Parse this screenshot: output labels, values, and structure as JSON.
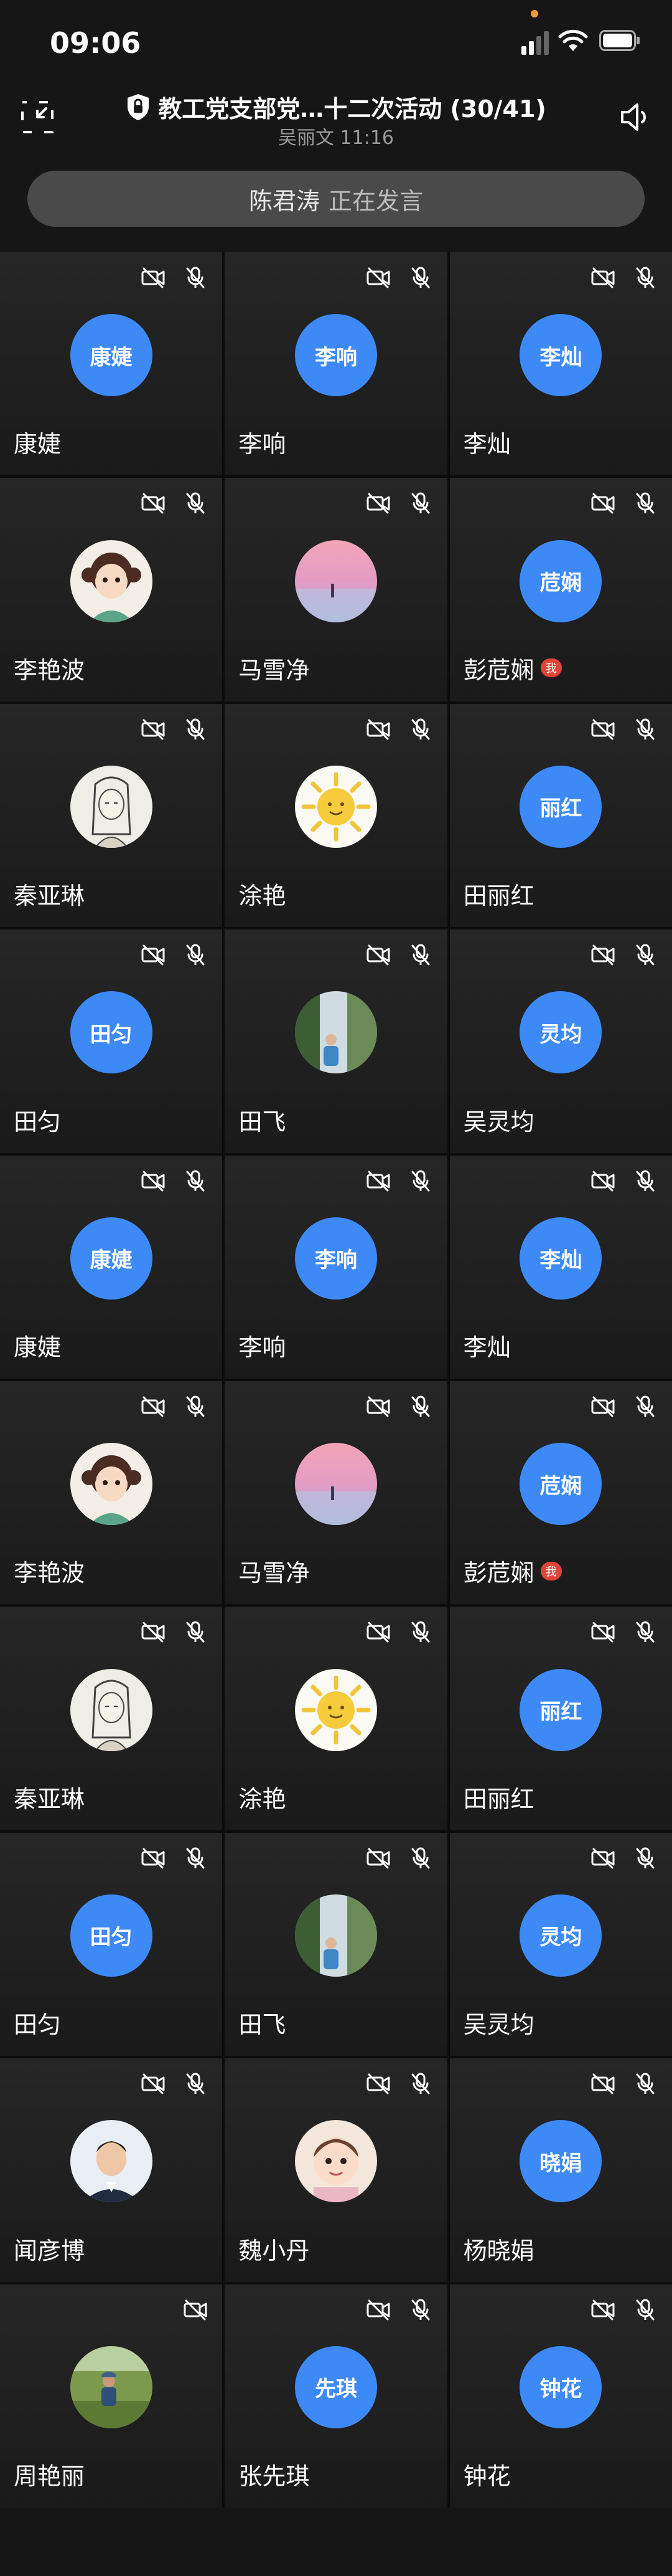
{
  "status_bar": {
    "time": "09:06"
  },
  "header": {
    "title": "教工党支部党…十二次活动 (30/41)",
    "subtitle": "吴丽文 11:16"
  },
  "speaking_banner": {
    "speaker": "陈君涛",
    "status": "正在发言"
  },
  "participants": [
    {
      "name": "康婕",
      "avatar_text": "康婕",
      "avatar_type": "text",
      "camera_off": true,
      "mic_off": true
    },
    {
      "name": "李响",
      "avatar_text": "李响",
      "avatar_type": "text",
      "camera_off": true,
      "mic_off": true
    },
    {
      "name": "李灿",
      "avatar_text": "李灿",
      "avatar_type": "text",
      "camera_off": true,
      "mic_off": true
    },
    {
      "name": "李艳波",
      "avatar_type": "photo",
      "avatar_icon": "cartoon-girl-avatar",
      "camera_off": true,
      "mic_off": true
    },
    {
      "name": "马雪净",
      "avatar_type": "photo",
      "avatar_icon": "sunset-avatar",
      "camera_off": true,
      "mic_off": true
    },
    {
      "name": "彭苊娴",
      "avatar_text": "苊娴",
      "avatar_type": "text",
      "camera_off": true,
      "mic_off": true,
      "badge": "我"
    },
    {
      "name": "秦亚琳",
      "avatar_type": "photo",
      "avatar_icon": "sketch-girl-avatar",
      "camera_off": true,
      "mic_off": true
    },
    {
      "name": "涂艳",
      "avatar_type": "photo",
      "avatar_icon": "sun-avatar",
      "camera_off": true,
      "mic_off": true
    },
    {
      "name": "田丽红",
      "avatar_text": "丽红",
      "avatar_type": "text",
      "camera_off": true,
      "mic_off": true
    },
    {
      "name": "田匀",
      "avatar_text": "田匀",
      "avatar_type": "text",
      "camera_off": true,
      "mic_off": true
    },
    {
      "name": "田飞",
      "avatar_type": "photo",
      "avatar_icon": "waterfall-avatar",
      "camera_off": true,
      "mic_off": true
    },
    {
      "name": "吴灵均",
      "avatar_text": "灵均",
      "avatar_type": "text",
      "camera_off": true,
      "mic_off": true
    },
    {
      "name": "康婕",
      "avatar_text": "康婕",
      "avatar_type": "text",
      "camera_off": true,
      "mic_off": true
    },
    {
      "name": "李响",
      "avatar_text": "李响",
      "avatar_type": "text",
      "camera_off": true,
      "mic_off": true
    },
    {
      "name": "李灿",
      "avatar_text": "李灿",
      "avatar_type": "text",
      "camera_off": true,
      "mic_off": true
    },
    {
      "name": "李艳波",
      "avatar_type": "photo",
      "avatar_icon": "cartoon-girl-avatar",
      "camera_off": true,
      "mic_off": true
    },
    {
      "name": "马雪净",
      "avatar_type": "photo",
      "avatar_icon": "sunset-avatar",
      "camera_off": true,
      "mic_off": true
    },
    {
      "name": "彭苊娴",
      "avatar_text": "苊娴",
      "avatar_type": "text",
      "camera_off": true,
      "mic_off": true,
      "badge": "我"
    },
    {
      "name": "秦亚琳",
      "avatar_type": "photo",
      "avatar_icon": "sketch-girl-avatar",
      "camera_off": true,
      "mic_off": true
    },
    {
      "name": "涂艳",
      "avatar_type": "photo",
      "avatar_icon": "sun-avatar",
      "camera_off": true,
      "mic_off": true
    },
    {
      "name": "田丽红",
      "avatar_text": "丽红",
      "avatar_type": "text",
      "camera_off": true,
      "mic_off": true
    },
    {
      "name": "田匀",
      "avatar_text": "田匀",
      "avatar_type": "text",
      "camera_off": true,
      "mic_off": true
    },
    {
      "name": "田飞",
      "avatar_type": "photo",
      "avatar_icon": "waterfall-avatar",
      "camera_off": true,
      "mic_off": true
    },
    {
      "name": "吴灵均",
      "avatar_text": "灵均",
      "avatar_type": "text",
      "camera_off": true,
      "mic_off": true
    },
    {
      "name": "闻彦博",
      "avatar_type": "photo",
      "avatar_icon": "man-portrait-avatar",
      "camera_off": true,
      "mic_off": true
    },
    {
      "name": "魏小丹",
      "avatar_type": "photo",
      "avatar_icon": "baby-avatar",
      "camera_off": true,
      "mic_off": true
    },
    {
      "name": "杨晓娟",
      "avatar_text": "晓娟",
      "avatar_type": "text",
      "camera_off": true,
      "mic_off": true
    },
    {
      "name": "周艳丽",
      "avatar_type": "photo",
      "avatar_icon": "field-avatar",
      "camera_off": true,
      "mic_off": false
    },
    {
      "name": "张先琪",
      "avatar_text": "先琪",
      "avatar_type": "text",
      "camera_off": true,
      "mic_off": true
    },
    {
      "name": "钟花",
      "avatar_text": "钟花",
      "avatar_type": "text",
      "camera_off": true,
      "mic_off": true
    }
  ],
  "colors": {
    "avatar_blue": "#3d8af7",
    "badge_red": "#e04438",
    "background": "#161616"
  }
}
